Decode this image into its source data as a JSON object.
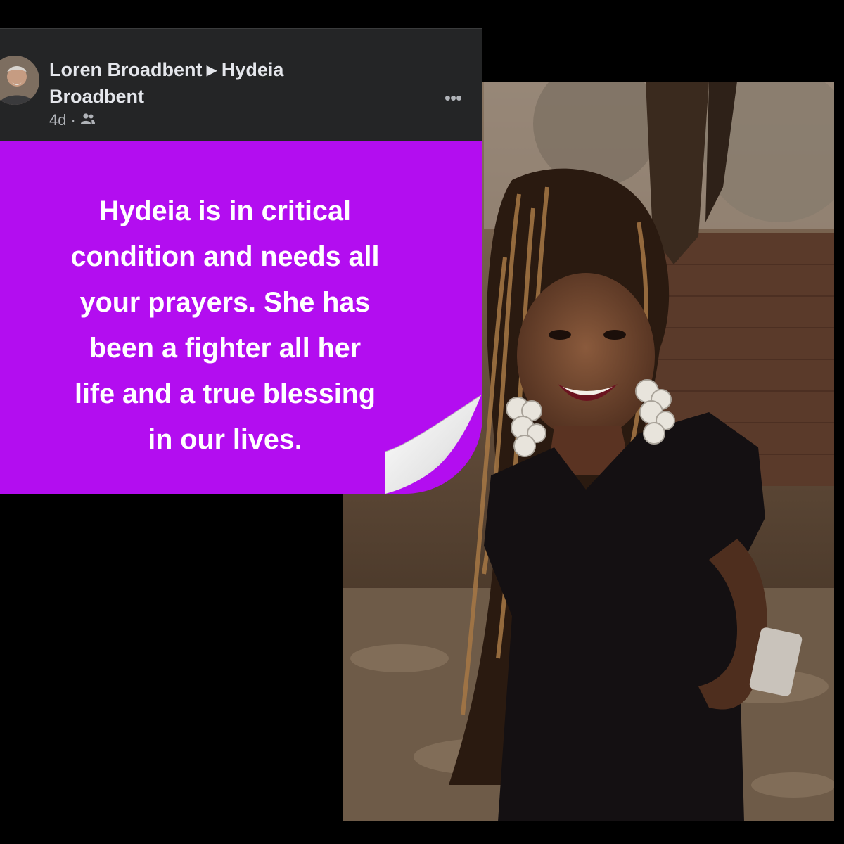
{
  "post": {
    "author": "Loren Broadbent",
    "target": "Hydeia Broadbent",
    "time": "4d",
    "separator": "·",
    "audience_icon": "friends-icon",
    "more_icon": "more-options-icon",
    "more_label": "•••"
  },
  "message": {
    "lines": [
      "Hydeia is in critical",
      "condition and needs all",
      "your prayers. She has",
      "been a fighter all her",
      "life and a true blessing",
      "in our lives."
    ]
  },
  "colors": {
    "background": "#000000",
    "card": "#242526",
    "text_primary": "#e4e6eb",
    "text_secondary": "#b0b3b8",
    "accent_purple": "#b30df0"
  }
}
